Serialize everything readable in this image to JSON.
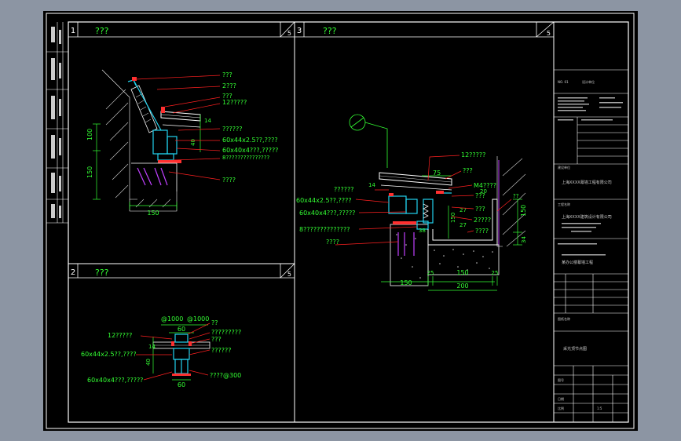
{
  "colors": {
    "background": "#8c95a3",
    "sheet": "#000000",
    "frame": "#ffffff",
    "callout": "#ff2020",
    "label": "#33ff33",
    "dimension": "#33ff33",
    "profile": "#22d3ee",
    "glass": "#ffffff",
    "anchor": "#c040ff",
    "plate": "#ff3030",
    "hatch": "#cccccc"
  },
  "panels": [
    {
      "number": "1",
      "title": "???",
      "sheet_mark": "5"
    },
    {
      "number": "2",
      "title": "???",
      "sheet_mark": "5"
    },
    {
      "number": "3",
      "title": "???",
      "sheet_mark": "5"
    }
  ],
  "detail1": {
    "callouts": [
      "???",
      "2???",
      "???",
      "12?????",
      "??????",
      "60x44x2.5??,????",
      "60x40x4???,?????",
      "8???????????????",
      "????"
    ],
    "dims": {
      "height_a": "100",
      "height_b": "150",
      "width": "150",
      "gap": "14",
      "depth": "40"
    }
  },
  "detail2": {
    "callouts_top": [
      "@1000",
      "@1000",
      "??",
      "?????????",
      "???",
      "??????",
      "????@300"
    ],
    "callouts_left": [
      "12?????",
      "60x44x2.5??,????",
      "60x40x4???,?????"
    ],
    "dims": {
      "top": "60",
      "bottom": "60",
      "gap": "14",
      "depth": "40"
    }
  },
  "detail3": {
    "callouts_right": [
      "12?????",
      "???",
      "M4????",
      "???",
      "???",
      "2????",
      "????",
      "??"
    ],
    "callouts_left": [
      "??????",
      "60x44x2.5??,????",
      "60x40x4???,?????",
      "8??????????????",
      "????"
    ],
    "dims": {
      "top": "75",
      "gap": "14",
      "a": "27",
      "b": "38",
      "c": "27",
      "h1": "20",
      "h2": "150",
      "h3": "34",
      "w1": "150",
      "w2": "25",
      "w3": "150",
      "w4": "25",
      "total": "200"
    }
  },
  "titleblock": {
    "cells": [
      "NO. 01",
      "设计单位",
      "上海XXXX幕墙工程有限公司",
      "建设单位",
      "上海XXXX建筑设计有限公司",
      "工程名称",
      "某办公楼幕墙工程",
      "图纸名称",
      "采光顶节点图",
      "图号",
      "日期",
      "比例",
      "1:5"
    ]
  }
}
